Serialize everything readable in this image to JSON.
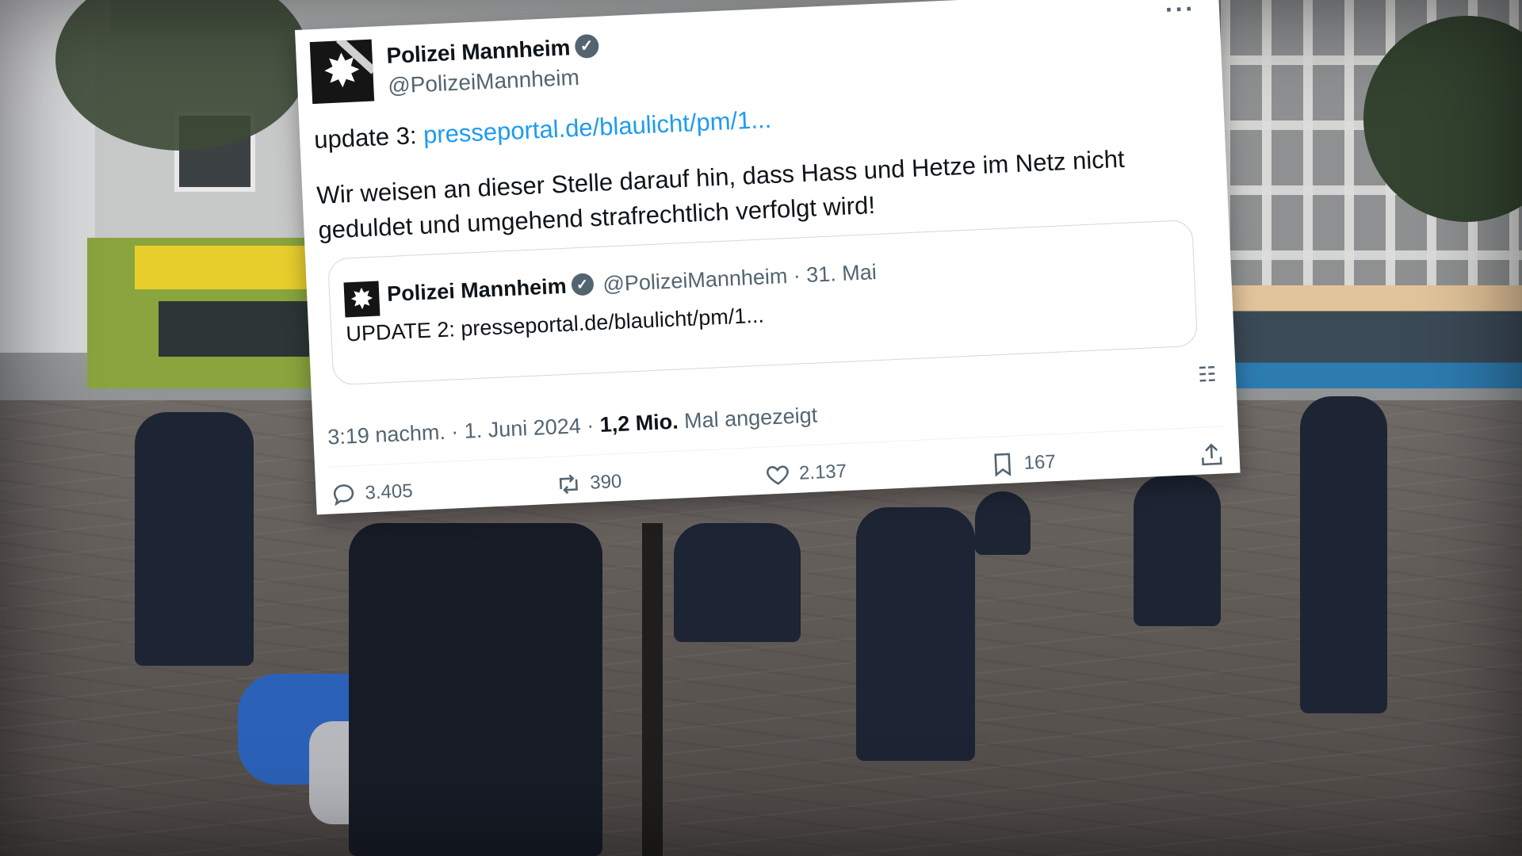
{
  "tweet": {
    "author_name": "Polizei Mannheim",
    "author_handle": "@PolizeiMannheim",
    "more_icon": "more-dots-icon",
    "update_prefix": "update 3: ",
    "update_link": "presseportal.de/blaulicht/pm/1...",
    "body": "Wir weisen an dieser Stelle darauf hin, dass Hass und Hetze im Netz nicht geduldet und umgehend strafrechtlich verfolgt wird!",
    "quoted": {
      "author_name": "Polizei Mannheim",
      "meta": "@PolizeiMannheim · 31. Mai",
      "text": "UPDATE 2: presseportal.de/blaulicht/pm/1..."
    },
    "timestamp": "3:19 nachm. · 1. Juni 2024 · ",
    "views_count": "1,2 Mio.",
    "views_label": " Mal angezeigt",
    "actions": {
      "replies": "3.405",
      "reposts": "390",
      "likes": "2.137",
      "bookmarks": "167"
    }
  },
  "colors": {
    "link": "#1d9bf0",
    "secondary_text": "#536471",
    "primary_text": "#0f1419",
    "card_bg": "#ffffff"
  }
}
